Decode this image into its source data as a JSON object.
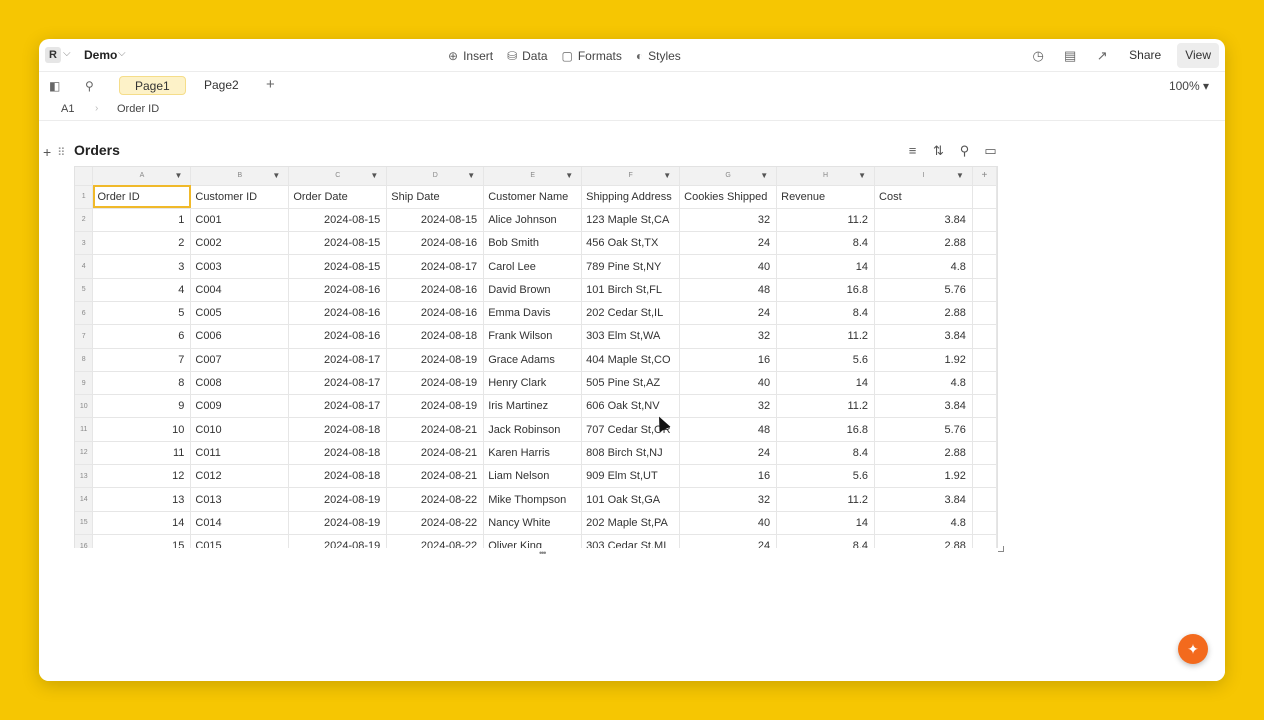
{
  "app": {
    "logo_letter": "R",
    "doc_title": "Demo"
  },
  "menu": {
    "insert": "Insert",
    "data": "Data",
    "formats": "Formats",
    "styles": "Styles"
  },
  "toolbar": {
    "share": "Share",
    "view": "View"
  },
  "pages": {
    "tabs": [
      {
        "label": "Page1"
      },
      {
        "label": "Page2"
      }
    ],
    "zoom": "100%"
  },
  "formula": {
    "cell_ref": "A1",
    "value": "Order ID"
  },
  "table": {
    "title": "Orders",
    "column_letters": [
      "A",
      "B",
      "C",
      "D",
      "E",
      "F",
      "G",
      "H",
      "I"
    ],
    "headers": [
      "Order ID",
      "Customer ID",
      "Order Date",
      "Ship Date",
      "Customer Name",
      "Shipping Address",
      "Cookies Shipped",
      "Revenue",
      "Cost"
    ],
    "rows": [
      [
        "1",
        "C001",
        "2024-08-15",
        "2024-08-15",
        "Alice Johnson",
        "123 Maple St,CA",
        "32",
        "11.2",
        "3.84"
      ],
      [
        "2",
        "C002",
        "2024-08-15",
        "2024-08-16",
        "Bob Smith",
        "456 Oak St,TX",
        "24",
        "8.4",
        "2.88"
      ],
      [
        "3",
        "C003",
        "2024-08-15",
        "2024-08-17",
        "Carol Lee",
        "789 Pine St,NY",
        "40",
        "14",
        "4.8"
      ],
      [
        "4",
        "C004",
        "2024-08-16",
        "2024-08-16",
        "David Brown",
        "101 Birch St,FL",
        "48",
        "16.8",
        "5.76"
      ],
      [
        "5",
        "C005",
        "2024-08-16",
        "2024-08-16",
        "Emma Davis",
        "202 Cedar St,IL",
        "24",
        "8.4",
        "2.88"
      ],
      [
        "6",
        "C006",
        "2024-08-16",
        "2024-08-18",
        "Frank Wilson",
        "303 Elm St,WA",
        "32",
        "11.2",
        "3.84"
      ],
      [
        "7",
        "C007",
        "2024-08-17",
        "2024-08-19",
        "Grace Adams",
        "404 Maple St,CO",
        "16",
        "5.6",
        "1.92"
      ],
      [
        "8",
        "C008",
        "2024-08-17",
        "2024-08-19",
        "Henry Clark",
        "505 Pine St,AZ",
        "40",
        "14",
        "4.8"
      ],
      [
        "9",
        "C009",
        "2024-08-17",
        "2024-08-19",
        "Iris Martinez",
        "606 Oak St,NV",
        "32",
        "11.2",
        "3.84"
      ],
      [
        "10",
        "C010",
        "2024-08-18",
        "2024-08-21",
        "Jack Robinson",
        "707 Cedar St,OR",
        "48",
        "16.8",
        "5.76"
      ],
      [
        "11",
        "C011",
        "2024-08-18",
        "2024-08-21",
        "Karen Harris",
        "808 Birch St,NJ",
        "24",
        "8.4",
        "2.88"
      ],
      [
        "12",
        "C012",
        "2024-08-18",
        "2024-08-21",
        "Liam Nelson",
        "909 Elm St,UT",
        "16",
        "5.6",
        "1.92"
      ],
      [
        "13",
        "C013",
        "2024-08-19",
        "2024-08-22",
        "Mike Thompson",
        "101 Oak St,GA",
        "32",
        "11.2",
        "3.84"
      ],
      [
        "14",
        "C014",
        "2024-08-19",
        "2024-08-22",
        "Nancy White",
        "202 Maple St,PA",
        "40",
        "14",
        "4.8"
      ],
      [
        "15",
        "C015",
        "2024-08-19",
        "2024-08-22",
        "Oliver King",
        "303 Cedar St,MI",
        "24",
        "8.4",
        "2.88"
      ]
    ]
  },
  "colors": {
    "accent": "#f0b92a",
    "background": "#f6c602",
    "fab": "#f36a1d"
  }
}
